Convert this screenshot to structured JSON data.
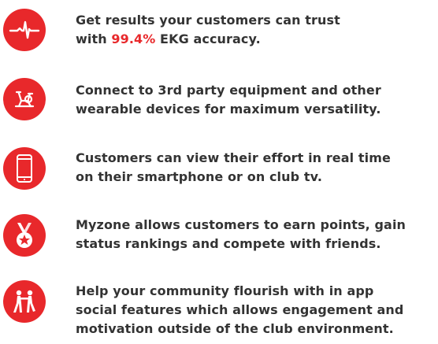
{
  "accent_color": "#e8282b",
  "text_color": "#333333",
  "features": [
    {
      "icon": "ekg-heartbeat-icon",
      "lines": [
        "Get results your customers can trust"
      ],
      "line2_prefix": "with ",
      "highlight": "99.4%",
      "line2_suffix": " EKG accuracy."
    },
    {
      "icon": "exercise-bike-icon",
      "lines": [
        "Connect to 3rd party equipment and other",
        "wearable devices for maximum versatility."
      ]
    },
    {
      "icon": "smartphone-icon",
      "lines": [
        "Customers can view their effort in real time",
        "on their smartphone or on club tv."
      ]
    },
    {
      "icon": "medal-icon",
      "lines": [
        "Myzone allows customers to earn points, gain",
        "status rankings and compete with friends."
      ]
    },
    {
      "icon": "community-people-icon",
      "lines": [
        "Help your community flourish with in app",
        "social features which allows engagement and",
        "motivation outside of the club environment."
      ]
    }
  ]
}
